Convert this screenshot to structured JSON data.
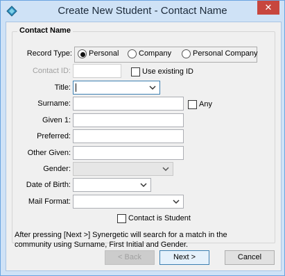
{
  "window": {
    "title": "Create New Student - Contact Name",
    "close_glyph": "✕"
  },
  "group": {
    "title": "Contact Name"
  },
  "record_type": {
    "label": "Record Type:",
    "options": [
      "Personal",
      "Company",
      "Personal Company"
    ],
    "selected": "Personal"
  },
  "contact_id": {
    "label": "Contact ID:",
    "value": "",
    "use_existing_label": "Use existing ID"
  },
  "title_field": {
    "label": "Title:",
    "value": ""
  },
  "surname": {
    "label": "Surname:",
    "value": "",
    "any_label": "Any"
  },
  "given1": {
    "label": "Given 1:",
    "value": ""
  },
  "preferred": {
    "label": "Preferred:",
    "value": ""
  },
  "other_given": {
    "label": "Other Given:",
    "value": ""
  },
  "gender": {
    "label": "Gender:",
    "value": ""
  },
  "dob": {
    "label": "Date of Birth:",
    "value": ""
  },
  "mail_format": {
    "label": "Mail Format:",
    "value": ""
  },
  "contact_is_student": {
    "label": "Contact is Student",
    "checked": false
  },
  "info_text": "After pressing [Next >] Synergetic will search for a match in the community using Surname, First Initial and Gender.",
  "buttons": {
    "back": "< Back",
    "next": "Next >",
    "cancel": "Cancel"
  }
}
